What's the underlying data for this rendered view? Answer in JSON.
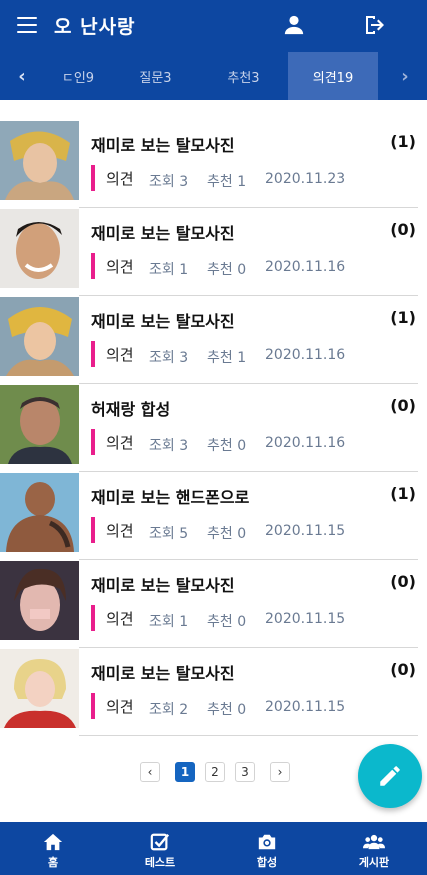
{
  "header": {
    "title": "오 난사랑",
    "menu_icon": "hamburger-menu-icon",
    "user_icon": "user-icon",
    "logout_icon": "logout-icon"
  },
  "tabs": {
    "prev_label": "‹",
    "next_label": "›",
    "items": [
      {
        "label": "ㄷ인9"
      },
      {
        "label": "질문3"
      },
      {
        "label": "추천3"
      },
      {
        "label": "의견19",
        "active": true
      }
    ]
  },
  "posts": [
    {
      "title": "재미로 보는 탈모사진",
      "count": "(1)",
      "category": "의견",
      "views": "조회 3",
      "likes": "추천 1",
      "date": "2020.11.23"
    },
    {
      "title": "재미로 보는 탈모사진",
      "count": "(0)",
      "category": "의견",
      "views": "조회 1",
      "likes": "추천 0",
      "date": "2020.11.16"
    },
    {
      "title": "재미로 보는 탈모사진",
      "count": "(1)",
      "category": "의견",
      "views": "조회 3",
      "likes": "추천 1",
      "date": "2020.11.16"
    },
    {
      "title": "허재랑 합성",
      "count": "(0)",
      "category": "의견",
      "views": "조회 3",
      "likes": "추천 0",
      "date": "2020.11.16"
    },
    {
      "title": "재미로 보는 핸드폰으로",
      "count": "(1)",
      "category": "의견",
      "views": "조회 5",
      "likes": "추천 0",
      "date": "2020.11.15"
    },
    {
      "title": "재미로 보는 탈모사진",
      "count": "(0)",
      "category": "의견",
      "views": "조회 1",
      "likes": "추천 0",
      "date": "2020.11.15"
    },
    {
      "title": "재미로 보는 탈모사진",
      "count": "(0)",
      "category": "의견",
      "views": "조회 2",
      "likes": "추천 0",
      "date": "2020.11.15"
    }
  ],
  "pagination": {
    "prev": "‹",
    "pages": [
      "1",
      "2",
      "3"
    ],
    "current": "1",
    "next": "›"
  },
  "fab": {
    "icon": "pencil-edit-icon"
  },
  "bottom_nav": [
    {
      "label": "홈",
      "icon": "home-icon"
    },
    {
      "label": "테스트",
      "icon": "checkbox-icon"
    },
    {
      "label": "합성",
      "icon": "camera-icon"
    },
    {
      "label": "게시판",
      "icon": "group-icon"
    }
  ],
  "colors": {
    "primary": "#0d47a1",
    "active_tab": "#3d6ab8",
    "accent_bar": "#e91e8c",
    "fab": "#0bb8cc",
    "page_active": "#1565c0"
  }
}
